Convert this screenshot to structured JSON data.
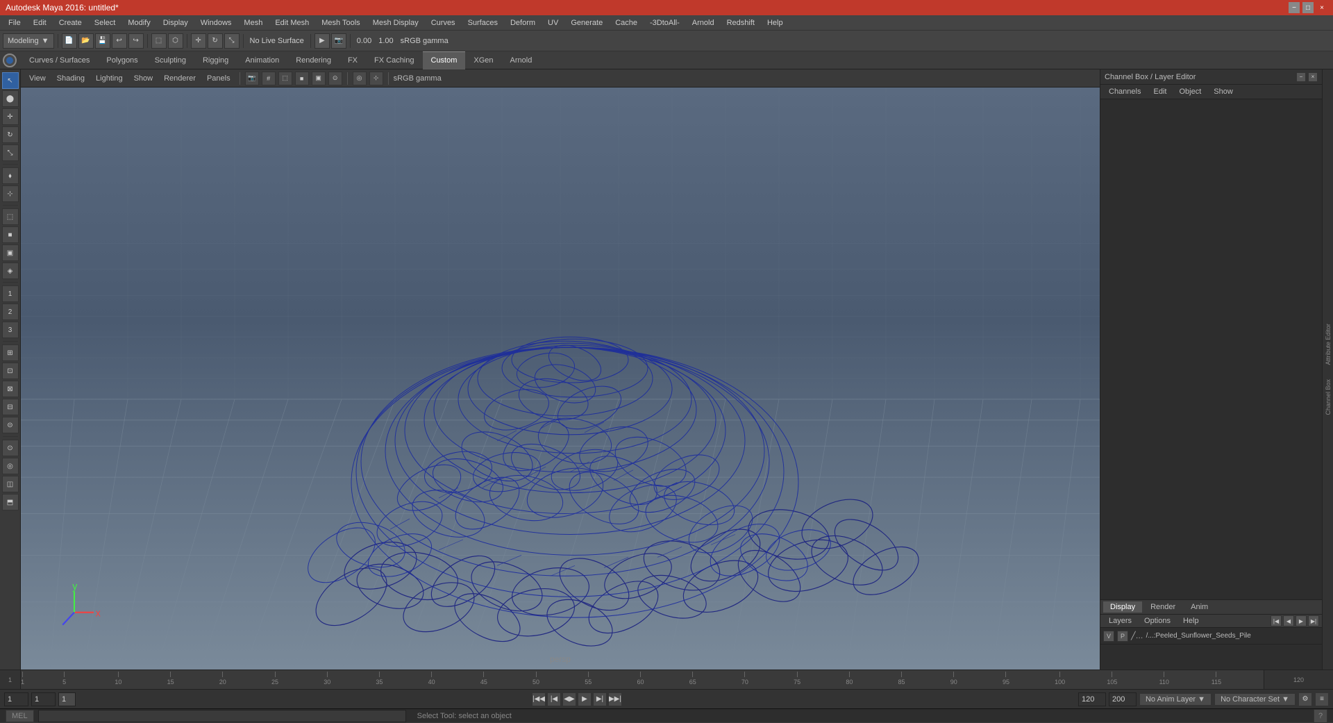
{
  "window": {
    "title": "Autodesk Maya 2016: untitled*",
    "controls": [
      "−",
      "□",
      "×"
    ]
  },
  "menu_bar": {
    "items": [
      "File",
      "Edit",
      "Create",
      "Select",
      "Modify",
      "Display",
      "Windows",
      "Mesh",
      "Edit Mesh",
      "Mesh Tools",
      "Mesh Display",
      "Curves",
      "Surfaces",
      "Deform",
      "UV",
      "Generate",
      "Cache",
      "-3DtoAll-",
      "Arnold",
      "Redshift",
      "Help"
    ]
  },
  "toolbar": {
    "mode_dropdown": "Modeling",
    "no_live_surface": "No Live Surface"
  },
  "tab_bar": {
    "tabs": [
      "Curves / Surfaces",
      "Polygons",
      "Sculpting",
      "Rigging",
      "Animation",
      "Rendering",
      "FX",
      "FX Caching",
      "Custom",
      "XGen",
      "Arnold"
    ]
  },
  "viewport": {
    "menus": [
      "View",
      "Shading",
      "Lighting",
      "Show",
      "Renderer",
      "Panels"
    ],
    "label": "persp",
    "gamma_label": "sRGB gamma"
  },
  "channel_box": {
    "title": "Channel Box / Layer Editor",
    "tabs": [
      "Channels",
      "Edit",
      "Object",
      "Show"
    ]
  },
  "display_tabs": {
    "tabs": [
      "Display",
      "Render",
      "Anim"
    ]
  },
  "layers": {
    "tabs": [
      "Layers",
      "Options",
      "Help"
    ],
    "items": [
      {
        "vis": "V",
        "p": "P",
        "name": "/...:Peeled_Sunflower_Seeds_Pile"
      }
    ]
  },
  "timeline": {
    "start": 1,
    "end": 120,
    "current": 1,
    "ticks": [
      1,
      5,
      10,
      15,
      20,
      25,
      30,
      35,
      40,
      45,
      50,
      55,
      60,
      65,
      70,
      75,
      80,
      85,
      90,
      95,
      100,
      105,
      110,
      115,
      120
    ]
  },
  "bottom_bar": {
    "frame_start": "1",
    "frame_current": "1",
    "frame_step": "1",
    "frame_end": "120",
    "range_start": "120",
    "range_end": "200",
    "anim_layer": "No Anim Layer",
    "char_set": "No Character Set"
  },
  "status_bar": {
    "mode": "MEL",
    "message": "Select Tool: select an object"
  },
  "toolbar_right_icons": {
    "icons": [
      "⊞",
      "⊠",
      "⊡"
    ]
  }
}
